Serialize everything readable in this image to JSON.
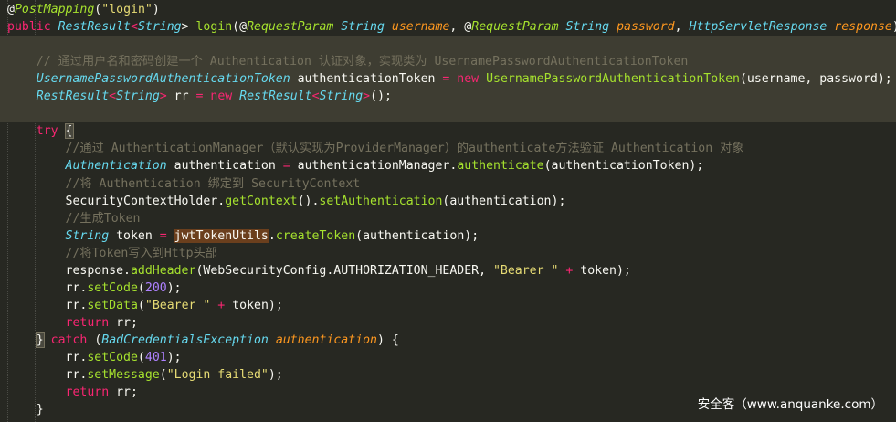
{
  "editor": {
    "watermark": "安全客（www.anquanke.com）",
    "lines": [
      [
        [
          "@",
          "o"
        ],
        [
          "PostMapping",
          "a"
        ],
        [
          "(",
          "o"
        ],
        [
          "\"login\"",
          "s"
        ],
        [
          ")",
          "o"
        ]
      ],
      [
        [
          "public ",
          "k"
        ],
        [
          "RestResult",
          "t"
        ],
        [
          "<",
          "e"
        ],
        [
          "String",
          "t"
        ],
        [
          "> ",
          "o"
        ],
        [
          "login",
          "f"
        ],
        [
          "(@",
          "o"
        ],
        [
          "RequestParam",
          "a"
        ],
        [
          " ",
          "o"
        ],
        [
          "String",
          "t"
        ],
        [
          " ",
          "o"
        ],
        [
          "username",
          "p"
        ],
        [
          ", @",
          "o"
        ],
        [
          "RequestParam",
          "a"
        ],
        [
          " ",
          "o"
        ],
        [
          "String",
          "t"
        ],
        [
          " ",
          "o"
        ],
        [
          "password",
          "p"
        ],
        [
          ", ",
          "o"
        ],
        [
          "HttpServletResponse",
          "t"
        ],
        [
          " ",
          "o"
        ],
        [
          "response",
          "p"
        ],
        [
          ") {",
          "o"
        ]
      ],
      [],
      [
        [
          "    // 通过用户名和密码创建一个 Authentication 认证对象，实现类为 UsernamePasswordAuthenticationToken",
          "c"
        ]
      ],
      [
        [
          "    ",
          "o"
        ],
        [
          "UsernamePasswordAuthenticationToken",
          "t"
        ],
        [
          " authenticationToken ",
          "o"
        ],
        [
          "=",
          "e"
        ],
        [
          " ",
          "o"
        ],
        [
          "new",
          "k"
        ],
        [
          " ",
          "o"
        ],
        [
          "UsernamePasswordAuthenticationToken",
          "f"
        ],
        [
          "(username, password);",
          "o"
        ]
      ],
      [
        [
          "    ",
          "o"
        ],
        [
          "RestResult",
          "t"
        ],
        [
          "<",
          "e"
        ],
        [
          "String",
          "t"
        ],
        [
          ">",
          "e"
        ],
        [
          " rr ",
          "o"
        ],
        [
          "=",
          "e"
        ],
        [
          " ",
          "o"
        ],
        [
          "new",
          "k"
        ],
        [
          " ",
          "o"
        ],
        [
          "RestResult",
          "t"
        ],
        [
          "<",
          "e"
        ],
        [
          "String",
          "t"
        ],
        [
          ">",
          "e"
        ],
        [
          "();",
          "o"
        ]
      ],
      [],
      [
        [
          "    ",
          "o"
        ],
        [
          "try",
          "k"
        ],
        [
          " ",
          "o"
        ],
        [
          "{",
          "h"
        ]
      ],
      [
        [
          "        //通过 AuthenticationManager（默认实现为ProviderManager）的authenticate方法验证 Authentication 对象",
          "c"
        ]
      ],
      [
        [
          "        ",
          "o"
        ],
        [
          "Authentication",
          "t"
        ],
        [
          " authentication ",
          "o"
        ],
        [
          "=",
          "e"
        ],
        [
          " authenticationManager.",
          "o"
        ],
        [
          "authenticate",
          "f"
        ],
        [
          "(authenticationToken);",
          "o"
        ]
      ],
      [
        [
          "        //将 Authentication 绑定到 SecurityContext",
          "c"
        ]
      ],
      [
        [
          "        SecurityContextHolder.",
          "o"
        ],
        [
          "getContext",
          "f"
        ],
        [
          "().",
          "o"
        ],
        [
          "setAuthentication",
          "f"
        ],
        [
          "(authentication);",
          "o"
        ]
      ],
      [
        [
          "        //生成Token",
          "c"
        ]
      ],
      [
        [
          "        ",
          "o"
        ],
        [
          "String",
          "t"
        ],
        [
          " token ",
          "o"
        ],
        [
          "=",
          "e"
        ],
        [
          " ",
          "o"
        ],
        [
          "jwtTokenUtils",
          "m"
        ],
        [
          ".",
          "o"
        ],
        [
          "createToken",
          "f"
        ],
        [
          "(authentication);",
          "o"
        ]
      ],
      [
        [
          "        //将Token写入到Http头部",
          "c"
        ]
      ],
      [
        [
          "        response.",
          "o"
        ],
        [
          "addHeader",
          "f"
        ],
        [
          "(WebSecurityConfig.AUTHORIZATION_HEADER, ",
          "o"
        ],
        [
          "\"Bearer \"",
          "s"
        ],
        [
          " ",
          "o"
        ],
        [
          "+",
          "e"
        ],
        [
          " token);",
          "o"
        ]
      ],
      [
        [
          "        rr.",
          "o"
        ],
        [
          "setCode",
          "f"
        ],
        [
          "(",
          "o"
        ],
        [
          "200",
          "n"
        ],
        [
          ");",
          "o"
        ]
      ],
      [
        [
          "        rr.",
          "o"
        ],
        [
          "setData",
          "f"
        ],
        [
          "(",
          "o"
        ],
        [
          "\"Bearer \"",
          "s"
        ],
        [
          " ",
          "o"
        ],
        [
          "+",
          "e"
        ],
        [
          " token);",
          "o"
        ]
      ],
      [
        [
          "        ",
          "o"
        ],
        [
          "return",
          "k"
        ],
        [
          " rr;",
          "o"
        ]
      ],
      [
        [
          "    ",
          "o"
        ],
        [
          "}",
          "h"
        ],
        [
          " ",
          "o"
        ],
        [
          "catch",
          "k"
        ],
        [
          " (",
          "o"
        ],
        [
          "BadCredentialsException",
          "t"
        ],
        [
          " ",
          "o"
        ],
        [
          "authentication",
          "p"
        ],
        [
          ") {",
          "o"
        ]
      ],
      [
        [
          "        rr.",
          "o"
        ],
        [
          "setCode",
          "f"
        ],
        [
          "(",
          "o"
        ],
        [
          "401",
          "n"
        ],
        [
          ");",
          "o"
        ]
      ],
      [
        [
          "        rr.",
          "o"
        ],
        [
          "setMessage",
          "f"
        ],
        [
          "(",
          "o"
        ],
        [
          "\"Login failed\"",
          "s"
        ],
        [
          ");",
          "o"
        ]
      ],
      [
        [
          "        ",
          "o"
        ],
        [
          "return",
          "k"
        ],
        [
          " rr;",
          "o"
        ]
      ],
      [
        [
          "    }",
          "o"
        ]
      ]
    ]
  }
}
